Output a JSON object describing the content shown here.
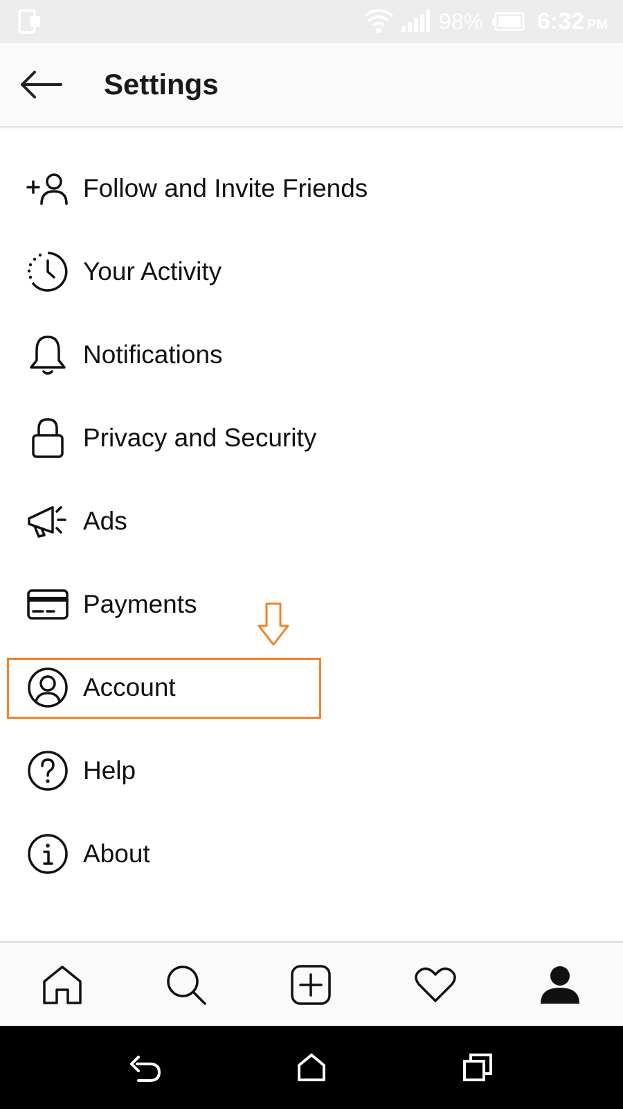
{
  "status_bar": {
    "battery_percent": "98%",
    "time": "6:32",
    "ampm": "PM",
    "icons": [
      "device-mode-icon",
      "wifi-icon",
      "signal-icon",
      "battery-icon"
    ]
  },
  "header": {
    "title": "Settings",
    "back_icon": "back-arrow-icon"
  },
  "menu": {
    "items": [
      {
        "label": "Follow and Invite Friends",
        "icon": "add-person-icon"
      },
      {
        "label": "Your Activity",
        "icon": "activity-clock-icon"
      },
      {
        "label": "Notifications",
        "icon": "bell-icon"
      },
      {
        "label": "Privacy and Security",
        "icon": "lock-icon"
      },
      {
        "label": "Ads",
        "icon": "megaphone-icon"
      },
      {
        "label": "Payments",
        "icon": "credit-card-icon"
      },
      {
        "label": "Account",
        "icon": "account-circle-icon"
      },
      {
        "label": "Help",
        "icon": "help-circle-icon"
      },
      {
        "label": "About",
        "icon": "info-circle-icon"
      }
    ],
    "highlighted_item": "Account",
    "highlight_color": "#f48225"
  },
  "tab_bar": {
    "tabs": [
      "home-icon",
      "search-icon",
      "new-post-icon",
      "heart-icon",
      "profile-icon"
    ],
    "active": "profile-icon"
  },
  "nav_bar": {
    "buttons": [
      "back-icon",
      "home-icon",
      "recents-icon"
    ]
  }
}
